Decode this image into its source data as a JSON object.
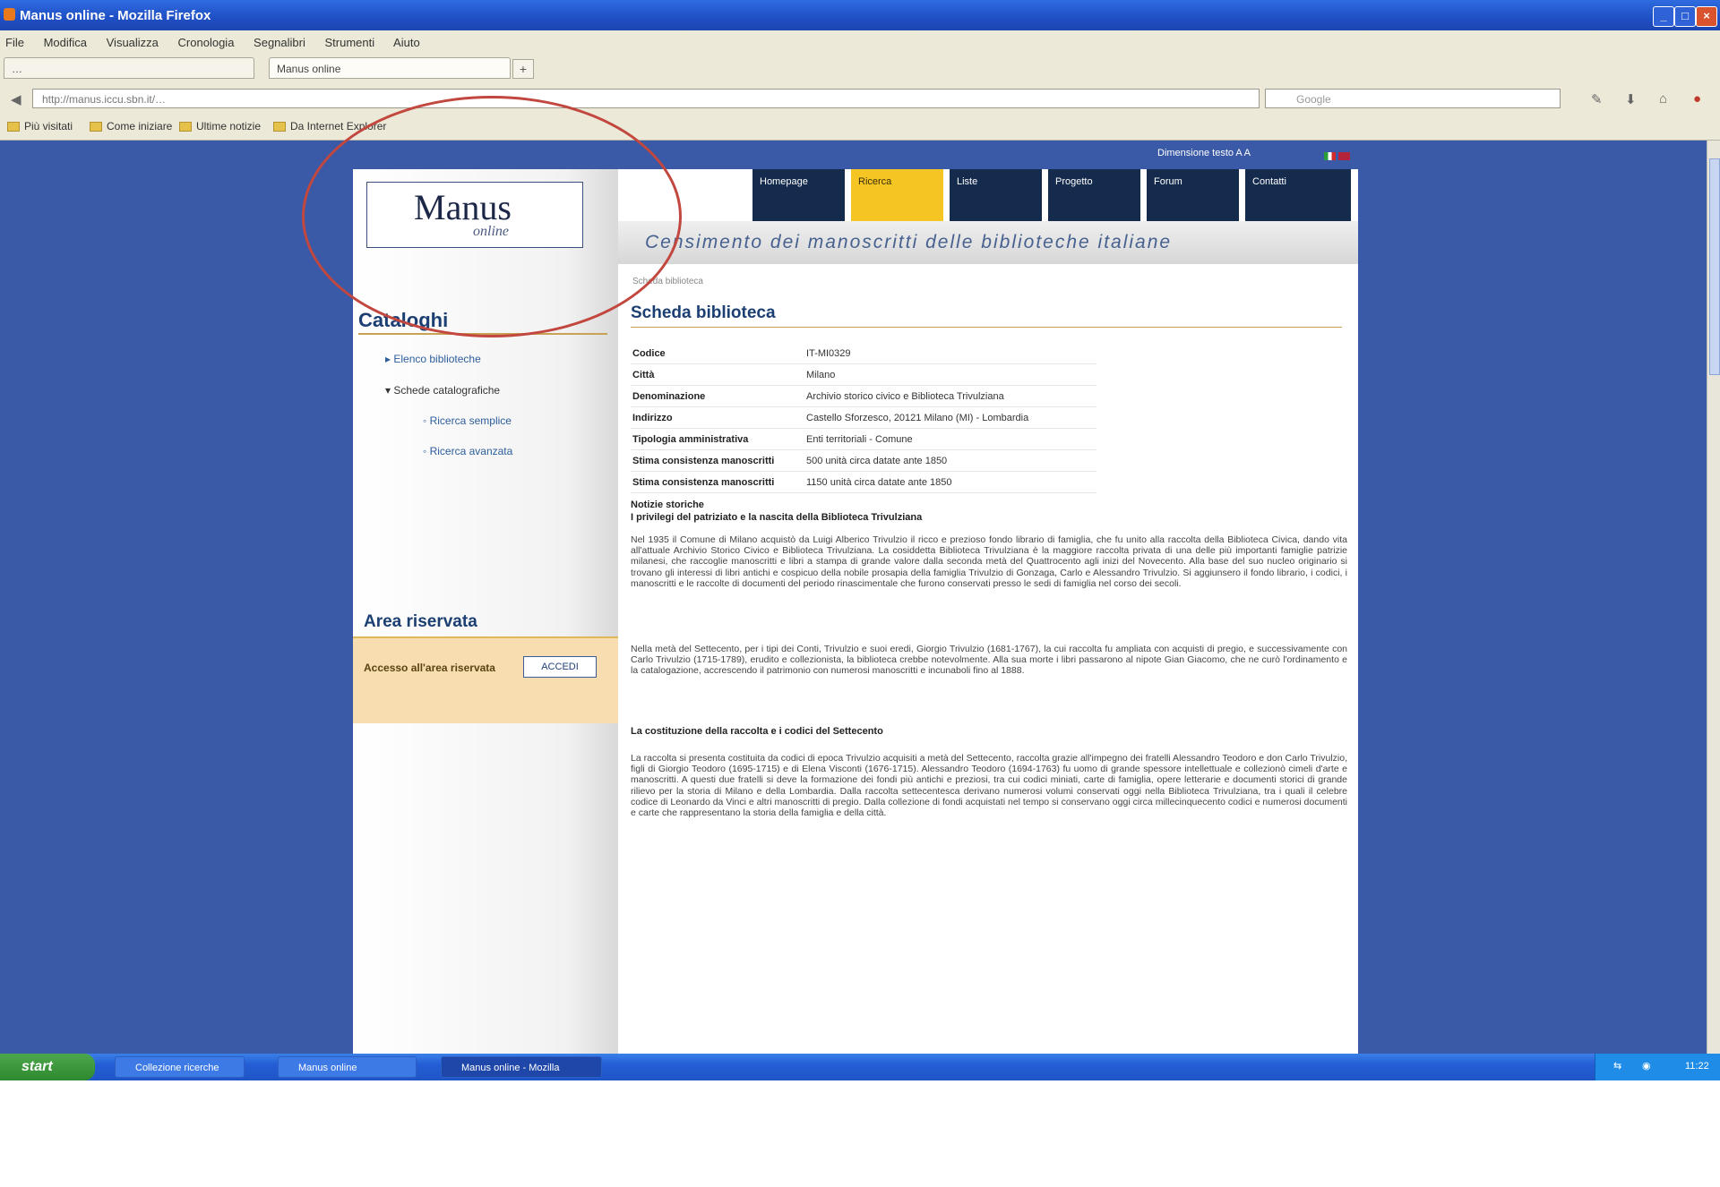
{
  "window": {
    "title": "Manus online - Mozilla Firefox"
  },
  "menubar": [
    "File",
    "Modifica",
    "Visualizza",
    "Cronologia",
    "Segnalibri",
    "Strumenti",
    "Aiuto"
  ],
  "tabs": [
    {
      "label": "…"
    },
    {
      "label": "Manus online"
    }
  ],
  "address": {
    "url": "http://manus.iccu.sbn.it/…",
    "search_placeholder": "Google"
  },
  "bookmarks": [
    "Più visitati",
    "Come iniziare",
    "Ultime notizie",
    "Da Internet Explorer"
  ],
  "site": {
    "top_links": "Dimensione testo A A",
    "logo_word": "Manus",
    "logo_script": "online",
    "nav": [
      "Homepage",
      "Ricerca",
      "Liste",
      "Progetto",
      "Forum",
      "Contatti"
    ],
    "banner": "Censimento dei manoscritti delle biblioteche italiane",
    "breadcrumb": "Scheda biblioteca",
    "sidebar": {
      "title": "Cataloghi",
      "items": [
        "Elenco biblioteche",
        "Schede catalografiche",
        "Ricerca semplice",
        "Ricerca avanzata"
      ],
      "reserved_title": "Area riservata",
      "reserved_label": "Accesso all'area riservata",
      "reserved_button": "ACCEDI"
    },
    "main": {
      "title": "Scheda biblioteca",
      "rows": [
        {
          "k": "Codice",
          "v": "IT-MI0329"
        },
        {
          "k": "Città",
          "v": "Milano"
        },
        {
          "k": "Denominazione",
          "v": "Archivio storico civico e Biblioteca Trivulziana"
        },
        {
          "k": "Indirizzo",
          "v": "Castello Sforzesco, 20121 Milano (MI) - Lombardia"
        },
        {
          "k": "Tipologia amministrativa",
          "v": "Enti territoriali - Comune"
        },
        {
          "k": "Stima consistenza manoscritti",
          "v": "500 unità circa datate ante 1850"
        },
        {
          "k": "Stima consistenza manoscritti",
          "v": "1150 unità circa datate ante 1850"
        }
      ],
      "notes_label": "Notizie storiche",
      "notes_sub": "I privilegi del patriziato e la nascita della Biblioteca Trivulziana",
      "p1": "Nel 1935 il Comune di Milano acquistò da Luigi Alberico Trivulzio il ricco e prezioso fondo librario di famiglia, che fu unito alla raccolta della Biblioteca Civica, dando vita all'attuale Archivio Storico Civico e Biblioteca Trivulziana. La cosiddetta Biblioteca Trivulziana è la maggiore raccolta privata di una delle più importanti famiglie patrizie milanesi, che raccoglie manoscritti e libri a stampa di grande valore dalla seconda metà del Quattrocento agli inizi del Novecento. Alla base del suo nucleo originario si trovano gli interessi di libri antichi e cospicuo della nobile prosapia della famiglia Trivulzio di Gonzaga, Carlo e Alessandro Trivulzio. Si aggiunsero il fondo librario, i codici, i manoscritti e le raccolte di documenti del periodo rinascimentale che furono conservati presso le sedi di famiglia nel corso dei secoli.",
      "p2": "Nella metà del Settecento, per i tipi dei Conti, Trivulzio e suoi eredi, Giorgio Trivulzio (1681-1767), la cui raccolta fu ampliata con acquisti di pregio, e successivamente con Carlo Trivulzio (1715-1789), erudito e collezionista, la biblioteca crebbe notevolmente. Alla sua morte i libri passarono al nipote Gian Giacomo, che ne curò l'ordinamento e la catalogazione, accrescendo il patrimonio con numerosi manoscritti e incunaboli fino al 1888.",
      "sub2": "La costituzione della raccolta e i codici del Settecento",
      "p3": "La raccolta si presenta costituita da codici di epoca Trivulzio acquisiti a metà del Settecento, raccolta grazie all'impegno dei fratelli Alessandro Teodoro e don Carlo Trivulzio, figli di Giorgio Teodoro (1695-1715) e di Elena Visconti (1676-1715). Alessandro Teodoro (1694-1763) fu uomo di grande spessore intellettuale e collezionò cimeli d'arte e manoscritti. A questi due fratelli si deve la formazione dei fondi più antichi e preziosi, tra cui codici miniati, carte di famiglia, opere letterarie e documenti storici di grande rilievo per la storia di Milano e della Lombardia. Dalla raccolta settecentesca derivano numerosi volumi conservati oggi nella Biblioteca Trivulziana, tra i quali il celebre codice di Leonardo da Vinci e altri manoscritti di pregio. Dalla collezione di fondi acquistati nel tempo si conservano oggi circa millecinquecento codici e numerosi documenti e carte che rappresentano la storia della famiglia e della città."
    }
  },
  "taskbar": {
    "start": "start",
    "tasks": [
      "Collezione ricerche",
      "Manus online",
      "Manus online - Mozilla"
    ],
    "clock": "11:22"
  }
}
